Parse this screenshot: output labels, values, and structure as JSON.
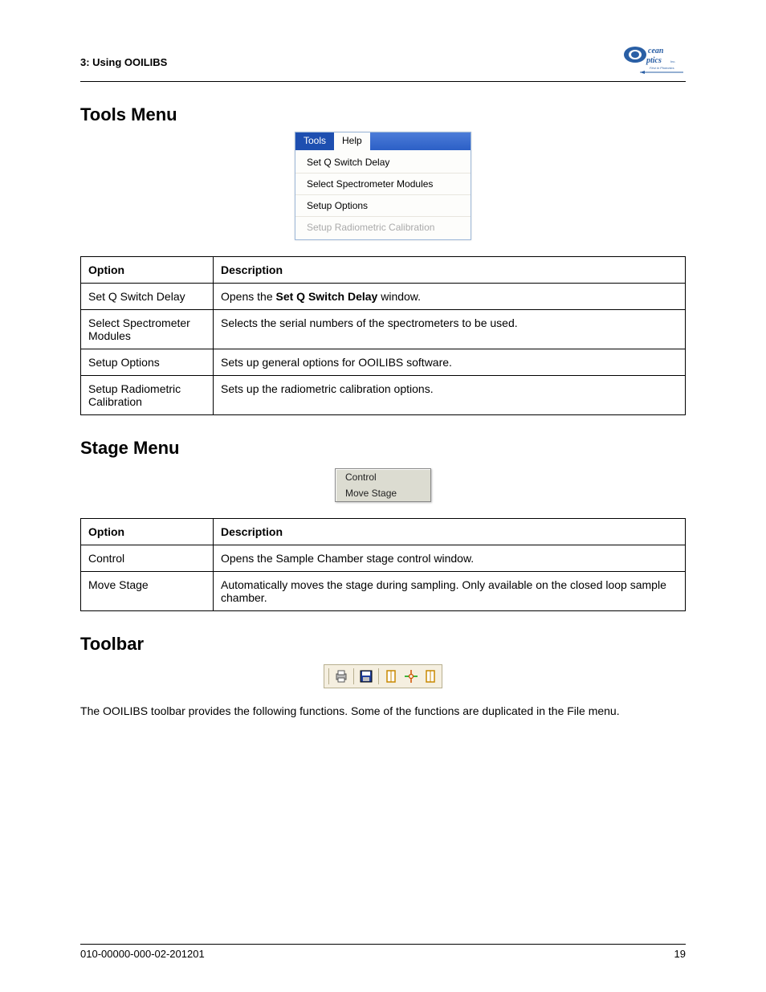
{
  "header": {
    "chapter": "3: Using OOILIBS",
    "logo_alt": "Ocean Optics Inc. — First in Photonics"
  },
  "sections": {
    "tools": {
      "title": "Tools Menu",
      "menu_tabs": {
        "active": "Tools",
        "inactive": "Help"
      },
      "menu_items": [
        {
          "label": "Set Q Switch Delay",
          "disabled": false
        },
        {
          "label": "Select Spectrometer Modules",
          "disabled": false
        },
        {
          "label": "Setup Options",
          "disabled": false
        },
        {
          "label": "Setup Radiometric Calibration",
          "disabled": true
        }
      ],
      "table": {
        "headers": {
          "option": "Option",
          "desc": "Description"
        },
        "rows": [
          {
            "option": "Set Q Switch Delay",
            "desc_pre": "Opens the ",
            "desc_link": "Set Q Switch Delay",
            "desc_post": " window."
          },
          {
            "option": "Select Spectrometer Modules",
            "desc": "Selects the serial numbers of the spectrometers to be used."
          },
          {
            "option": "Setup Options",
            "desc": "Sets up general options for OOILIBS software."
          },
          {
            "option": "Setup Radiometric Calibration",
            "desc": "Sets up the radiometric calibration options."
          }
        ]
      }
    },
    "stage": {
      "title": "Stage Menu",
      "menu_items": [
        "Control",
        "Move Stage"
      ],
      "table": {
        "headers": {
          "option": "Option",
          "desc": "Description"
        },
        "rows": [
          {
            "option": "Control",
            "desc": "Opens the Sample Chamber stage control window."
          },
          {
            "option": "Move Stage",
            "desc": "Automatically moves the stage during sampling. Only available on the closed loop sample chamber."
          }
        ]
      }
    },
    "toolbar": {
      "title": "Toolbar",
      "icons": [
        "print-icon",
        "save-icon",
        "panel-1-icon",
        "target-icon",
        "panel-2-icon"
      ],
      "body": "The OOILIBS toolbar provides the following functions. Some of the functions are duplicated in the File menu."
    }
  },
  "footer": {
    "doc": "010-00000-000-02-201201",
    "page": "19"
  }
}
